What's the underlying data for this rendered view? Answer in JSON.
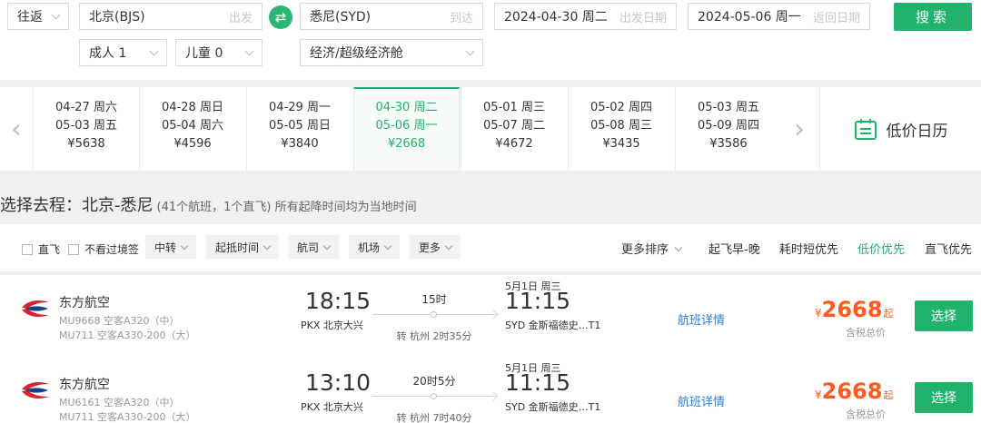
{
  "search": {
    "trip_type": "往返",
    "from": "北京(BJS)",
    "from_hint": "出发",
    "to": "悉尼(SYD)",
    "to_hint": "到达",
    "depart_date": "2024-04-30 周二",
    "depart_hint": "出发日期",
    "return_date": "2024-05-06 周一",
    "return_hint": "返回日期",
    "adults": "成人 1",
    "children": "儿童 0",
    "cabin": "经济/超级经济舱",
    "search_label": "搜索",
    "swap_icon": "swap-arrows-icon"
  },
  "date_strip": {
    "items": [
      {
        "out": "04-27 周六",
        "ret": "05-03 周五",
        "price": "¥5638"
      },
      {
        "out": "04-28 周日",
        "ret": "05-04 周六",
        "price": "¥4596"
      },
      {
        "out": "04-29 周一",
        "ret": "05-05 周日",
        "price": "¥3840"
      },
      {
        "out": "04-30 周二",
        "ret": "05-06 周一",
        "price": "¥2668"
      },
      {
        "out": "05-01 周三",
        "ret": "05-07 周二",
        "price": "¥4672"
      },
      {
        "out": "05-02 周四",
        "ret": "05-08 周三",
        "price": "¥3435"
      },
      {
        "out": "05-03 周五",
        "ret": "05-09 周四",
        "price": "¥3586"
      }
    ],
    "active_index": 3,
    "low_price_calendar": "低价日历"
  },
  "route": {
    "title": "选择去程：北京-悉尼",
    "subtitle": "(41个航班，1个直飞) 所有起降时间均为当地时间"
  },
  "filters": {
    "nonstop": "直飞",
    "no_transit_visa": "不看过境签",
    "transfer": "中转",
    "times": "起抵时间",
    "airline": "航司",
    "airport": "机场",
    "more": "更多",
    "more_sort": "更多排序",
    "sort_early": "起飞早-晚",
    "sort_short": "耗时短优先",
    "sort_low": "低价优先",
    "sort_direct": "直飞优先"
  },
  "flights": [
    {
      "airline": "东方航空",
      "flight1": "MU9668 空客A320（中）",
      "flight2": "MU711 空客A330-200（大）",
      "dep_time": "18:15",
      "dep_airport": "PKX 北京大兴",
      "duration": "15时",
      "transfer": "转 杭州 2时35分",
      "arr_date": "5月1日 周三",
      "arr_time": "11:15",
      "arr_airport": "SYD 金斯福德史…T1",
      "detail": "航班详情",
      "currency": "¥",
      "price": "2668",
      "price_suffix": "起",
      "tax_note": "含税总价",
      "select": "选择"
    },
    {
      "airline": "东方航空",
      "flight1": "MU6161 空客A320（中）",
      "flight2": "MU711 空客A330-200（大）",
      "dep_time": "13:10",
      "dep_airport": "PKX 北京大兴",
      "duration": "20时5分",
      "transfer": "转 杭州 7时40分",
      "arr_date": "5月1日 周三",
      "arr_time": "11:15",
      "arr_airport": "SYD 金斯福德史…T1",
      "detail": "航班详情",
      "currency": "¥",
      "price": "2668",
      "price_suffix": "起",
      "tax_note": "含税总价",
      "select": "选择"
    }
  ],
  "colors": {
    "accent": "#21b26c",
    "price": "#ff5a1f",
    "link": "#2a7fd4"
  }
}
